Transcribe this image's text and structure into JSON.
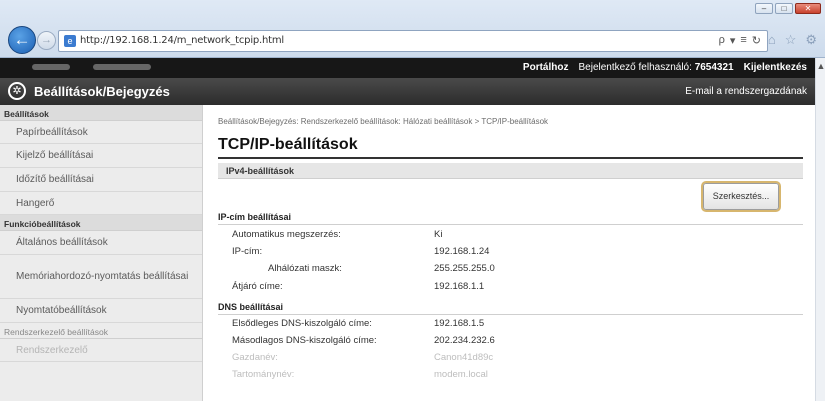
{
  "browser": {
    "url": "http://192.168.1.24/m_network_tcpip.html",
    "search_icon": "search-icon",
    "refresh_icon": "refresh-icon",
    "addr_icons": "ρ - ≡ ¢"
  },
  "topbar": {
    "portal_link": "Portálhoz",
    "user_label": "Bejelentkező felhasználó:",
    "user_id": "7654321",
    "logout_link": "Kijelentkezés"
  },
  "titlebar": {
    "title": "Beállítások/Bejegyzés",
    "mail_link": "E-mail a rendszergazdának"
  },
  "sidebar": {
    "section1": "Beállítások",
    "items1": [
      "Papírbeállítások",
      "Kijelző beállításai",
      "Időzítő beállításai",
      "Hangerő"
    ],
    "section2": "Funkcióbeállítások",
    "items2": [
      "Általános beállítások",
      "Memóriahordozó-nyomtatás beállításai",
      "Nyomtatóbeállítások"
    ],
    "section3": "Rendszerkezelő beállítások",
    "items3": [
      "Rendszerkezelő"
    ]
  },
  "main": {
    "breadcrumb": "Beállítások/Bejegyzés: Rendszerkezelő beállítások: Hálózati beállítások > TCP/IP-beállítások",
    "title": "TCP/IP-beállítások",
    "section": "IPv4-beállítások",
    "edit_button": "Szerkesztés...",
    "ip_head": "IP-cím beállításai",
    "ip_rows": [
      {
        "label": "Automatikus megszerzés:",
        "value": "Ki"
      },
      {
        "label": "IP-cím:",
        "value": "192.168.1.24"
      },
      {
        "label": "Alhálózati maszk:",
        "value": "255.255.255.0"
      },
      {
        "label": "Átjáró címe:",
        "value": "192.168.1.1"
      }
    ],
    "dns_head": "DNS beállításai",
    "dns_rows": [
      {
        "label": "Elsődleges DNS-kiszolgáló címe:",
        "value": "192.168.1.5"
      },
      {
        "label": "Másodlagos DNS-kiszolgáló címe:",
        "value": "202.234.232.6"
      },
      {
        "label": "Gazdanév:",
        "value": "Canon41d89c"
      },
      {
        "label": "Tartománynév:",
        "value": "modem.local"
      }
    ]
  }
}
